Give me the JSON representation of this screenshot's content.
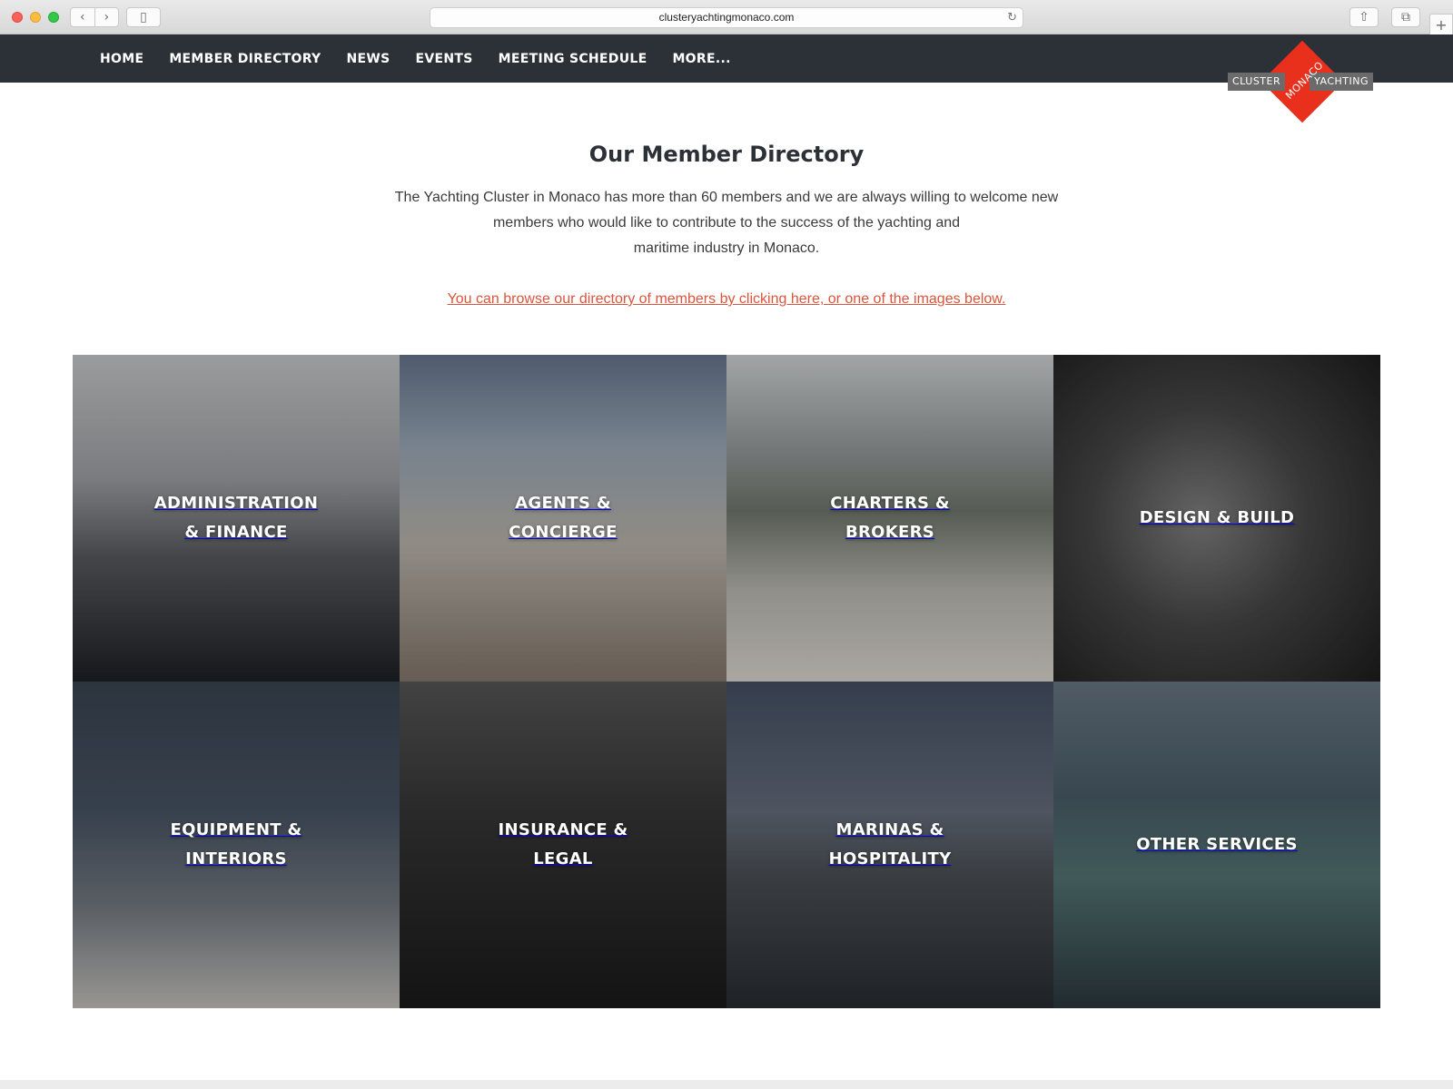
{
  "browser": {
    "url": "clusteryachtingmonaco.com",
    "back_glyph": "‹",
    "forward_glyph": "›",
    "sidebar_glyph": "▯",
    "reload_glyph": "↻",
    "share_glyph": "⇧",
    "tabs_glyph": "⧉",
    "newtab_glyph": "+"
  },
  "nav": {
    "items": [
      {
        "label": "HOME"
      },
      {
        "label": "MEMBER DIRECTORY"
      },
      {
        "label": "NEWS"
      },
      {
        "label": "EVENTS"
      },
      {
        "label": "MEETING SCHEDULE"
      },
      {
        "label": "MORE..."
      }
    ]
  },
  "logo": {
    "left": "CLUSTER",
    "middle": "MONACO",
    "right": "YACHTING",
    "color": "#e8301c"
  },
  "page": {
    "title": "Our Member Directory",
    "intro_lines": [
      "The Yachting Cluster in Monaco has more than 60 members and we are always willing to welcome new",
      "members who would like to contribute to the success of the yachting and",
      "maritime industry in Monaco."
    ],
    "browse_link": "You can browse our directory of members by clicking here, or one of the images below.",
    "link_color": "#d9553c"
  },
  "categories": [
    {
      "label": "ADMINISTRATION\n& FINANCE"
    },
    {
      "label": "AGENTS &\nCONCIERGE"
    },
    {
      "label": "CHARTERS &\nBROKERS"
    },
    {
      "label": "DESIGN & BUILD"
    },
    {
      "label": "EQUIPMENT &\nINTERIORS"
    },
    {
      "label": "INSURANCE &\nLEGAL"
    },
    {
      "label": "MARINAS &\nHOSPITALITY"
    },
    {
      "label": "OTHER SERVICES"
    }
  ]
}
